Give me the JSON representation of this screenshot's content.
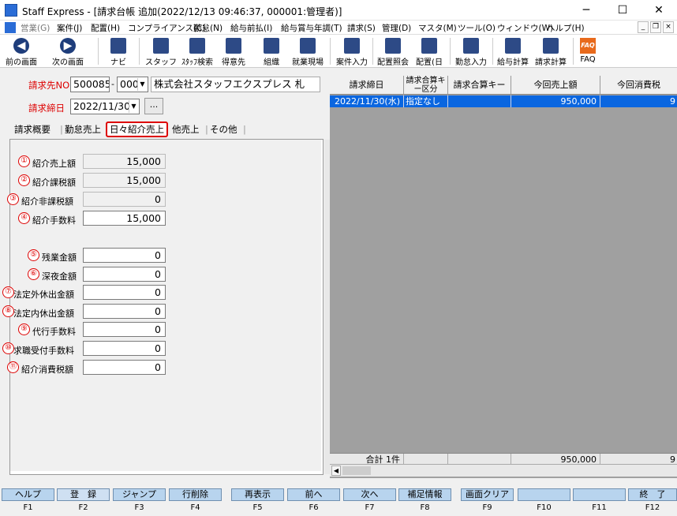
{
  "window": {
    "title": "Staff Express - [請求台帳 追加(2022/12/13 09:46:37, 000001:管理者)]",
    "minimize": "─",
    "maximize": "☐",
    "close": "✕"
  },
  "menu": [
    "営業(G)",
    "案件(J)",
    "配置(H)",
    "コンプライアンス(C)",
    "勤怠(N)",
    "給与前払(I)",
    "給与賞与年調(T)",
    "請求(S)",
    "管理(D)",
    "マスタ(M)",
    "ツール(O)",
    "ウィンドウ(W)",
    "ヘルプ(H)"
  ],
  "mdi": {
    "min": "_",
    "restore": "❐",
    "close": "×"
  },
  "toolbar": {
    "prev": "前の画面",
    "next": "次の画面",
    "navi": "ナビ",
    "staff": "スタッフ",
    "staff_search": "ｽﾀｯﾌ検索",
    "client": "得意先",
    "org": "組織",
    "worksite": "就業現場",
    "job_entry": "案件入力",
    "assign_inquiry": "配置照会",
    "assign_day": "配置(日",
    "attendance": "勤怠入力",
    "payroll": "給与計算",
    "billing": "請求計算",
    "faq": "FAQ"
  },
  "form": {
    "billing_no_label": "請求先NO",
    "billing_no": "500085",
    "billing_no_sep": "-",
    "billing_sub": "000",
    "client_name": "株式会社スタッフエクスプレス 札",
    "close_date_label": "請求締日",
    "close_date": "2022/11/30",
    "ellipsis": "..."
  },
  "tabs": [
    "請求概要",
    "勤怠売上",
    "日々紹介売上",
    "他売上",
    "その他"
  ],
  "fields": [
    {
      "num": "①",
      "label": "紹介売上額",
      "value": "15,000",
      "readonly": true
    },
    {
      "num": "②",
      "label": "紹介課税額",
      "value": "15,000",
      "readonly": true
    },
    {
      "num": "③",
      "label": "紹介非課税額",
      "value": "0",
      "readonly": true
    },
    {
      "num": "④",
      "label": "紹介手数料",
      "value": "15,000",
      "readonly": false
    },
    {
      "num": "⑤",
      "label": "残業金額",
      "value": "0",
      "readonly": false
    },
    {
      "num": "⑥",
      "label": "深夜金額",
      "value": "0",
      "readonly": false
    },
    {
      "num": "⑦",
      "label": "法定外休出金額",
      "value": "0",
      "readonly": false
    },
    {
      "num": "⑧",
      "label": "法定内休出金額",
      "value": "0",
      "readonly": false
    },
    {
      "num": "⑨",
      "label": "代行手数料",
      "value": "0",
      "readonly": false
    },
    {
      "num": "⑩",
      "label": "求職受付手数料",
      "value": "0",
      "readonly": false
    },
    {
      "num": "⑪",
      "label": "紹介消費税額",
      "value": "0",
      "readonly": false
    }
  ],
  "grid": {
    "headers": [
      "請求締日",
      "請求合算キー区分",
      "請求合算キー",
      "今回売上額",
      "今回消費税"
    ],
    "rows": [
      {
        "date": "2022/11/30(水)",
        "kind": "指定なし",
        "key": "",
        "sales": "950,000",
        "tax": "9"
      }
    ],
    "total_label": "合計 1件",
    "total_sales": "950,000",
    "total_tax": "9"
  },
  "fkeys": [
    {
      "label": "ヘルプ",
      "key": "F1"
    },
    {
      "label": "登　録",
      "key": "F2"
    },
    {
      "label": "ジャンプ",
      "key": "F3"
    },
    {
      "label": "行削除",
      "key": "F4"
    },
    {
      "label": "再表示",
      "key": "F5"
    },
    {
      "label": "前へ",
      "key": "F6"
    },
    {
      "label": "次へ",
      "key": "F7"
    },
    {
      "label": "補足情報",
      "key": "F8"
    },
    {
      "label": "画面クリア",
      "key": "F9"
    },
    {
      "label": "",
      "key": "F10"
    },
    {
      "label": "",
      "key": "F11"
    },
    {
      "label": "終　了",
      "key": "F12"
    }
  ]
}
